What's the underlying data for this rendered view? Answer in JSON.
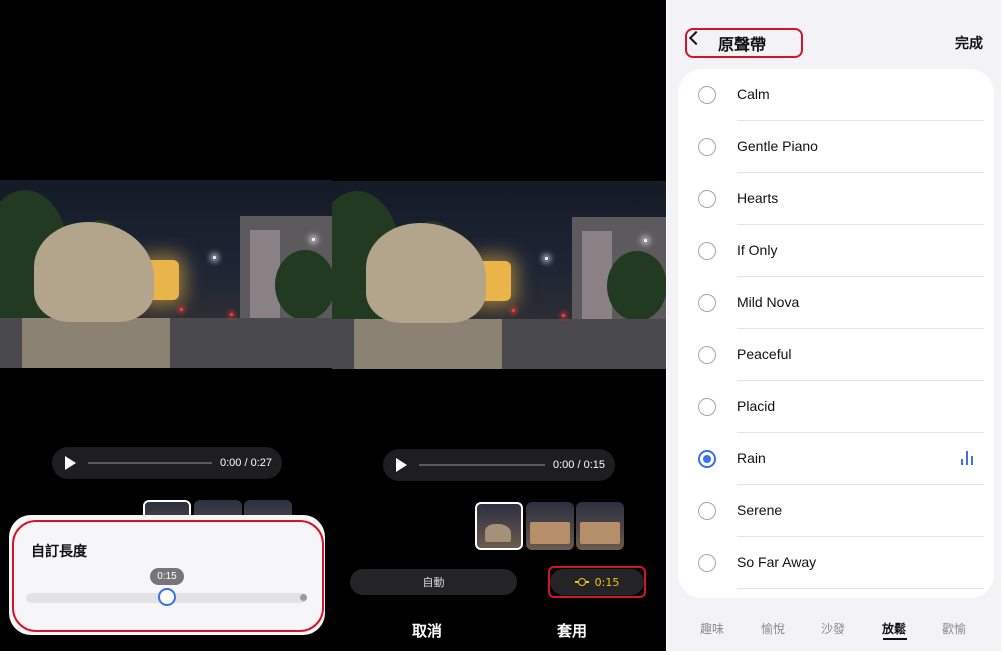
{
  "left_panel": {
    "player": {
      "time": "0:00 / 0:27"
    },
    "custom_length": {
      "title": "自訂長度",
      "value_label": "0:15"
    }
  },
  "middle_panel": {
    "player": {
      "time": "0:00 / 0:15"
    },
    "auto_label": "自動",
    "length_label": "0:15",
    "cancel_label": "取消",
    "apply_label": "套用"
  },
  "right_panel": {
    "title": "原聲帶",
    "done_label": "完成",
    "tracks": [
      {
        "label": "Calm",
        "selected": false
      },
      {
        "label": "Gentle Piano",
        "selected": false
      },
      {
        "label": "Hearts",
        "selected": false
      },
      {
        "label": "If Only",
        "selected": false
      },
      {
        "label": "Mild Nova",
        "selected": false
      },
      {
        "label": "Peaceful",
        "selected": false
      },
      {
        "label": "Placid",
        "selected": false
      },
      {
        "label": "Rain",
        "selected": true
      },
      {
        "label": "Serene",
        "selected": false
      },
      {
        "label": "So Far Away",
        "selected": false
      }
    ],
    "tabs": [
      {
        "label": "趣味"
      },
      {
        "label": "愉悅"
      },
      {
        "label": "沙發"
      },
      {
        "label": "放鬆"
      },
      {
        "label": "歡愉"
      }
    ],
    "active_tab": "放鬆"
  },
  "colors": {
    "accent": "#3b6ff0",
    "highlight_yellow": "#f2c318",
    "annotation_red": "#d4142a"
  }
}
